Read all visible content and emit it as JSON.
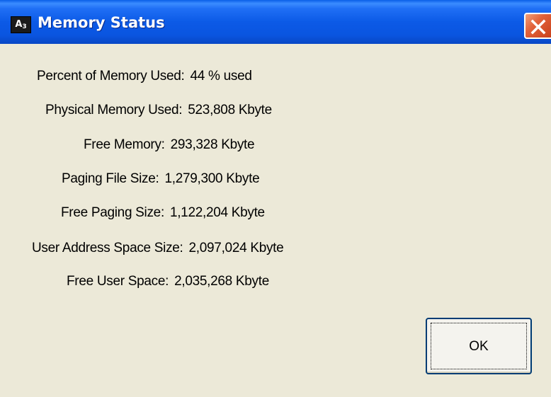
{
  "window": {
    "title": "Memory Status",
    "icon_text": "A",
    "icon_sub": "3",
    "close_icon": "close-icon"
  },
  "stats": [
    {
      "label": "Percent of Memory Used:",
      "value": "44 % used"
    },
    {
      "label": "Physical Memory Used:",
      "value": "523,808 Kbyte"
    },
    {
      "label": "Free Memory:",
      "value": "293,328 Kbyte"
    },
    {
      "label": "Paging File Size:",
      "value": "1,279,300 Kbyte"
    },
    {
      "label": "Free Paging Size:",
      "value": "1,122,204 Kbyte"
    },
    {
      "label": "User Address Space Size:",
      "value": "2,097,024 Kbyte"
    },
    {
      "label": "Free User Space:",
      "value": "2,035,268 Kbyte"
    }
  ],
  "buttons": {
    "ok_label": "OK"
  },
  "colors": {
    "titlebar": "#0a55e0",
    "dialog_bg": "#ece9d8",
    "close_button": "#e2623a"
  }
}
